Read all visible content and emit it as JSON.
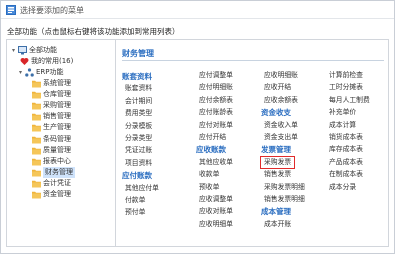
{
  "window": {
    "title": "选择要添加的菜单"
  },
  "hint": "全部功能（点击鼠标右键将该功能添加到常用列表）",
  "tree": {
    "root": "全部功能",
    "favorites": "我的常用(16)",
    "erp": "ERP功能",
    "modules": [
      "系统管理",
      "仓库管理",
      "采购管理",
      "销售管理",
      "生产管理",
      "条码管理",
      "质量管理",
      "报表中心",
      "财务管理",
      "会计凭证",
      "资金管理"
    ],
    "selected": "财务管理"
  },
  "content": {
    "section_title": "财务管理",
    "columns": [
      [
        {
          "t": "账套资料",
          "h": true
        },
        {
          "t": "账套资料"
        },
        {
          "t": "会计期间"
        },
        {
          "t": "费用类型"
        },
        {
          "t": "分录模板"
        },
        {
          "t": "分录类型"
        },
        {
          "t": "凭证过账"
        },
        {
          "t": "项目资料"
        },
        {
          "t": "应付账款",
          "h": true
        },
        {
          "t": "其他应付单"
        },
        {
          "t": "付款单"
        },
        {
          "t": "预付单"
        }
      ],
      [
        {
          "t": "应付调整单"
        },
        {
          "t": "应付明细账"
        },
        {
          "t": "应付余额表"
        },
        {
          "t": "应付账龄表"
        },
        {
          "t": "应付对账单"
        },
        {
          "t": "应付开结"
        },
        {
          "t": "应收账款",
          "h": true
        },
        {
          "t": "其他应收单"
        },
        {
          "t": "收款单"
        },
        {
          "t": "预收单"
        },
        {
          "t": "应收调整单"
        },
        {
          "t": "应收对账单"
        },
        {
          "t": "应收明细单"
        }
      ],
      [
        {
          "t": "应收明细账"
        },
        {
          "t": "应收开结"
        },
        {
          "t": "应收余额表"
        },
        {
          "t": "资金收支",
          "h": true
        },
        {
          "t": "资金收入单"
        },
        {
          "t": "资金支出单"
        },
        {
          "t": "发票管理",
          "h": true
        },
        {
          "t": "采购发票",
          "highlight": true
        },
        {
          "t": "销售发票"
        },
        {
          "t": "采购发票明细"
        },
        {
          "t": "销售发票明细"
        },
        {
          "t": "成本管理",
          "h": true
        },
        {
          "t": "成本开账"
        }
      ],
      [
        {
          "t": "计算前检查"
        },
        {
          "t": "工时分摊表"
        },
        {
          "t": "每月人工制费"
        },
        {
          "t": "补充单价"
        },
        {
          "t": "成本计算"
        },
        {
          "t": "销货成本表"
        },
        {
          "t": "库存成本表"
        },
        {
          "t": "产品成本表"
        },
        {
          "t": "在制成本表"
        },
        {
          "t": "成本分录"
        }
      ]
    ]
  },
  "colors": {
    "accent": "#2a6dc0",
    "folder": "#f0b43c",
    "highlight": "#e02b2b",
    "selected_bg": "#cfe3fb"
  }
}
